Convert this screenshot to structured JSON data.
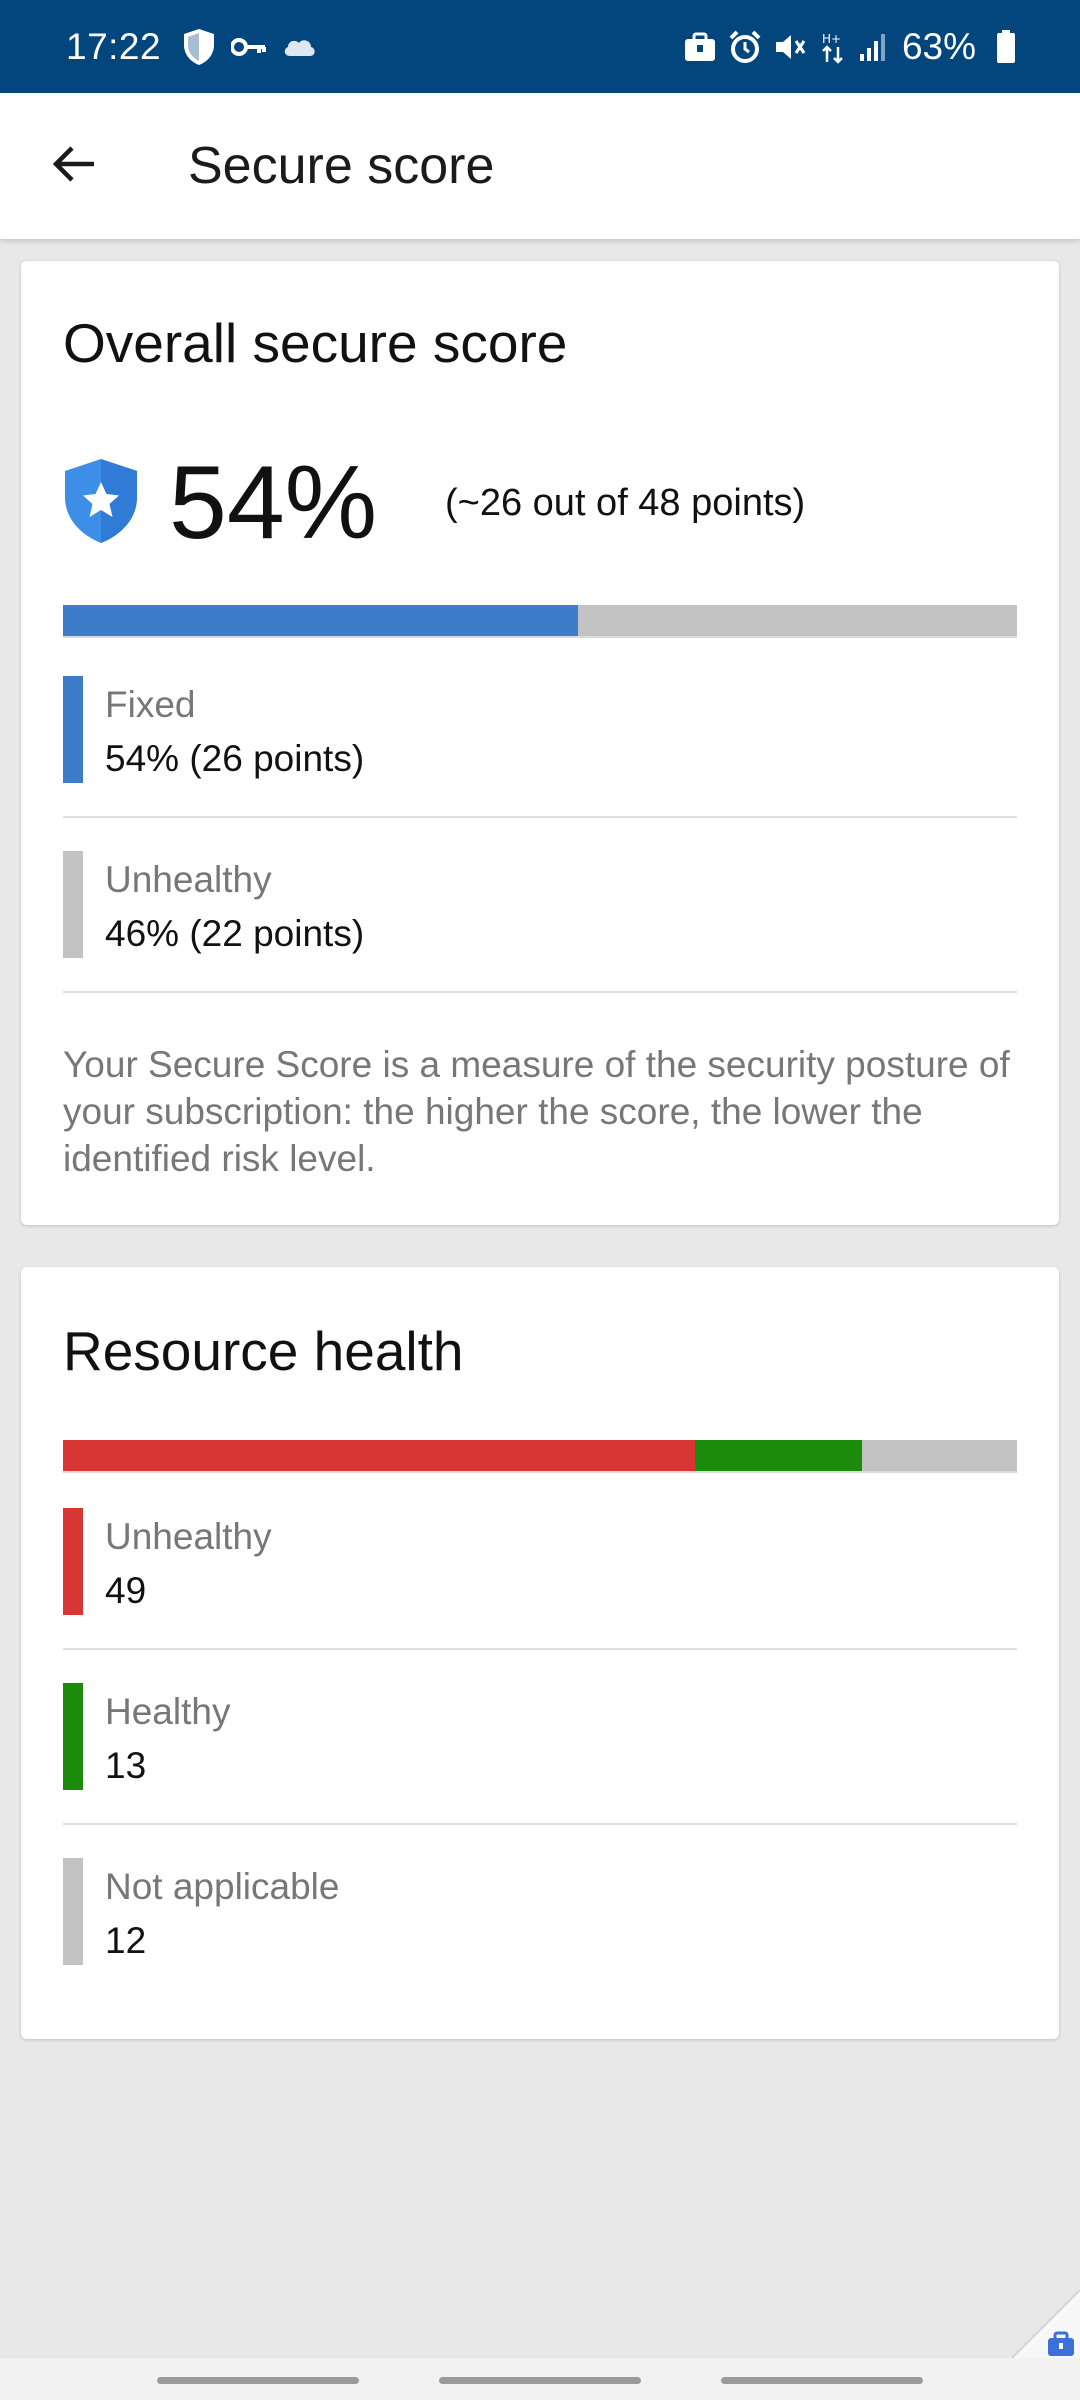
{
  "status_bar": {
    "time": "17:22",
    "battery": "63%",
    "left_icons": [
      "shield-icon",
      "key-icon",
      "cloud-icon"
    ],
    "right_icons": [
      "briefcase-icon",
      "alarm-icon",
      "mute-icon",
      "data-icon",
      "signal-icon",
      "battery-icon"
    ]
  },
  "app_bar": {
    "title": "Secure score",
    "back_icon": "arrow-left-icon"
  },
  "score_card": {
    "title": "Overall secure score",
    "percent": "54%",
    "detail": "(~26 out of 48 points)",
    "bar_fixed_fraction": 0.54,
    "legend": [
      {
        "label": "Fixed",
        "value": "54% (26 points)",
        "color": "#3d7cc9"
      },
      {
        "label": "Unhealthy",
        "value": "46% (22 points)",
        "color": "#c2c2c2"
      }
    ],
    "description": "Your Secure Score is a measure of the security posture of your subscription: the higher the score, the lower the identified risk level."
  },
  "health_card": {
    "title": "Resource health",
    "legend": [
      {
        "label": "Unhealthy",
        "value": "49",
        "count": 49,
        "color": "#d83535"
      },
      {
        "label": "Healthy",
        "value": "13",
        "count": 13,
        "color": "#1a8c0a"
      },
      {
        "label": "Not applicable",
        "value": "12",
        "count": 12,
        "color": "#c2c2c2"
      }
    ]
  },
  "colors": {
    "status_bar": "#03467e",
    "accent_blue": "#3d7cc9",
    "background": "#e8e8e8"
  }
}
